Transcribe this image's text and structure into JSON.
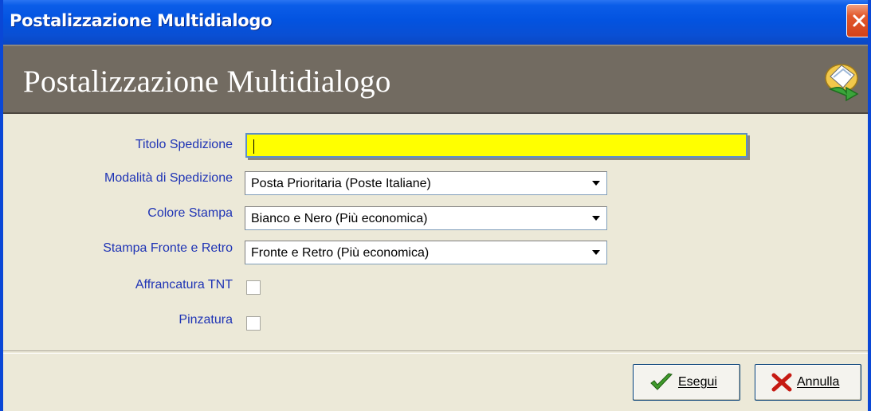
{
  "window": {
    "title": "Postalizzazione Multidialogo",
    "close_icon": "close-icon"
  },
  "header": {
    "title": "Postalizzazione Multidialogo",
    "icon": "mail-send-icon"
  },
  "form": {
    "titolo_label": "Titolo Spedizione",
    "titolo_value": "",
    "modalita_label": "Modalità di Spedizione",
    "modalita_value": "Posta Prioritaria (Poste Italiane)",
    "colore_label": "Colore Stampa",
    "colore_value": "Bianco e Nero (Più economica)",
    "fronte_label": "Stampa Fronte e Retro",
    "fronte_value": "Fronte e Retro (Più economica)",
    "tnt_label": "Affrancatura TNT",
    "tnt_checked": false,
    "pinzatura_label": "Pinzatura",
    "pinzatura_checked": false
  },
  "buttons": {
    "esegui_label": "Esegui",
    "esegui_icon": "checkmark-icon",
    "annulla_label": "Annulla",
    "annulla_icon": "cross-icon"
  },
  "colors": {
    "titlebar": "#0353e0",
    "header_band": "#726b61",
    "label_text": "#1f34b5",
    "required_field": "#ffff00",
    "dialog_bg": "#ece9d8"
  }
}
